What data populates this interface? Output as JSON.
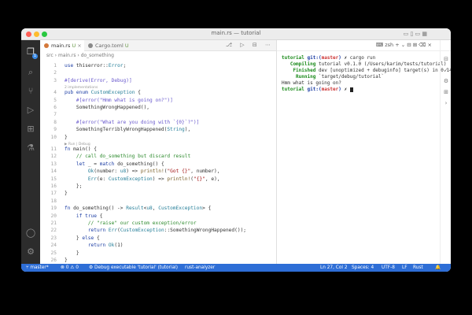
{
  "window": {
    "title": "main.rs — tutorial"
  },
  "activity_bar": {
    "icons": [
      "files-icon",
      "search-icon",
      "source-control-icon",
      "run-debug-icon",
      "extensions-icon",
      "testing-icon",
      "account-icon",
      "gear-icon"
    ],
    "badge": "1"
  },
  "tabs": [
    {
      "label": "main.rs",
      "status": "U"
    },
    {
      "label": "Cargo.toml",
      "status": "U"
    }
  ],
  "breadcrumb": {
    "folder": "src",
    "file": "main.rs",
    "symbol": "do_something"
  },
  "code_lines": [
    {
      "n": "1",
      "text": "use thiserror::Error;"
    },
    {
      "n": "2",
      "text": ""
    },
    {
      "n": "3",
      "text": "#[derive(Error, Debug)]"
    },
    {
      "lens": "2 implementations"
    },
    {
      "n": "4",
      "text": "pub enum CustomException {"
    },
    {
      "n": "5",
      "text": "    #[error(\"Hmm what is going on?\")]"
    },
    {
      "n": "6",
      "text": "    SomethingWrongHappened(),"
    },
    {
      "n": "7",
      "text": ""
    },
    {
      "n": "8",
      "text": "    #[error(\"What are you doing with `{0}`?\")]"
    },
    {
      "n": "9",
      "text": "    SomethingTerriblyWrongHappened(String),"
    },
    {
      "n": "10",
      "text": "}"
    },
    {
      "lens": "▶ Run | Debug"
    },
    {
      "n": "11",
      "text": "fn main() {"
    },
    {
      "n": "12",
      "text": "    // call do_something but discard result"
    },
    {
      "n": "13",
      "text": "    let _ = match do_something() {"
    },
    {
      "n": "14",
      "text": "        Ok(number: u8) => println!(\"Got {}\", number),"
    },
    {
      "n": "15",
      "text": "        Err(e: CustomException) => println!(\"{}\", e),"
    },
    {
      "n": "16",
      "text": "    };"
    },
    {
      "n": "17",
      "text": "}"
    },
    {
      "n": "18",
      "text": ""
    },
    {
      "n": "19",
      "text": "fn do_something() -> Result<u8, CustomException> {"
    },
    {
      "n": "20",
      "text": "    if true {"
    },
    {
      "n": "21",
      "text": "        // \"raise\" our custom exception/error"
    },
    {
      "n": "22",
      "text": "        return Err(CustomException::SomethingWrongHappened());"
    },
    {
      "n": "23",
      "text": "    } else {"
    },
    {
      "n": "24",
      "text": "        return Ok(1)"
    },
    {
      "n": "25",
      "text": "    }"
    },
    {
      "n": "26",
      "text": "}"
    },
    {
      "n": "27",
      "text": ""
    }
  ],
  "terminal": {
    "shell": "zsh",
    "lines": [
      {
        "prompt": "tutorial git:(master) ✗",
        "cmd": " cargo run"
      },
      {
        "label": "   Compiling",
        "rest": " tutorial v0.1.0 (/Users/karim/tests/tutorial)"
      },
      {
        "label": "    Finished",
        "rest": " dev [unoptimized + debuginfo] target(s) in 0.14s"
      },
      {
        "label": "     Running",
        "rest": " `target/debug/tutorial`"
      },
      {
        "plain": "Hmm what is going on?"
      },
      {
        "prompt": "tutorial git:(master) ✗",
        "cmd": " "
      }
    ]
  },
  "status_bar": {
    "branch": "master*",
    "problems": "⊗ 0 ⚠ 0",
    "debug": "Debug executable 'tutorial' (tutorial)",
    "analyzer": "rust-analyzer",
    "position": "Ln 27, Col 2",
    "spaces": "Spaces: 4",
    "encoding": "UTF-8",
    "eol": "LF",
    "language": "Rust"
  },
  "colors": {
    "accent": "#2e6ed6",
    "activity": "#2c2c2c"
  }
}
